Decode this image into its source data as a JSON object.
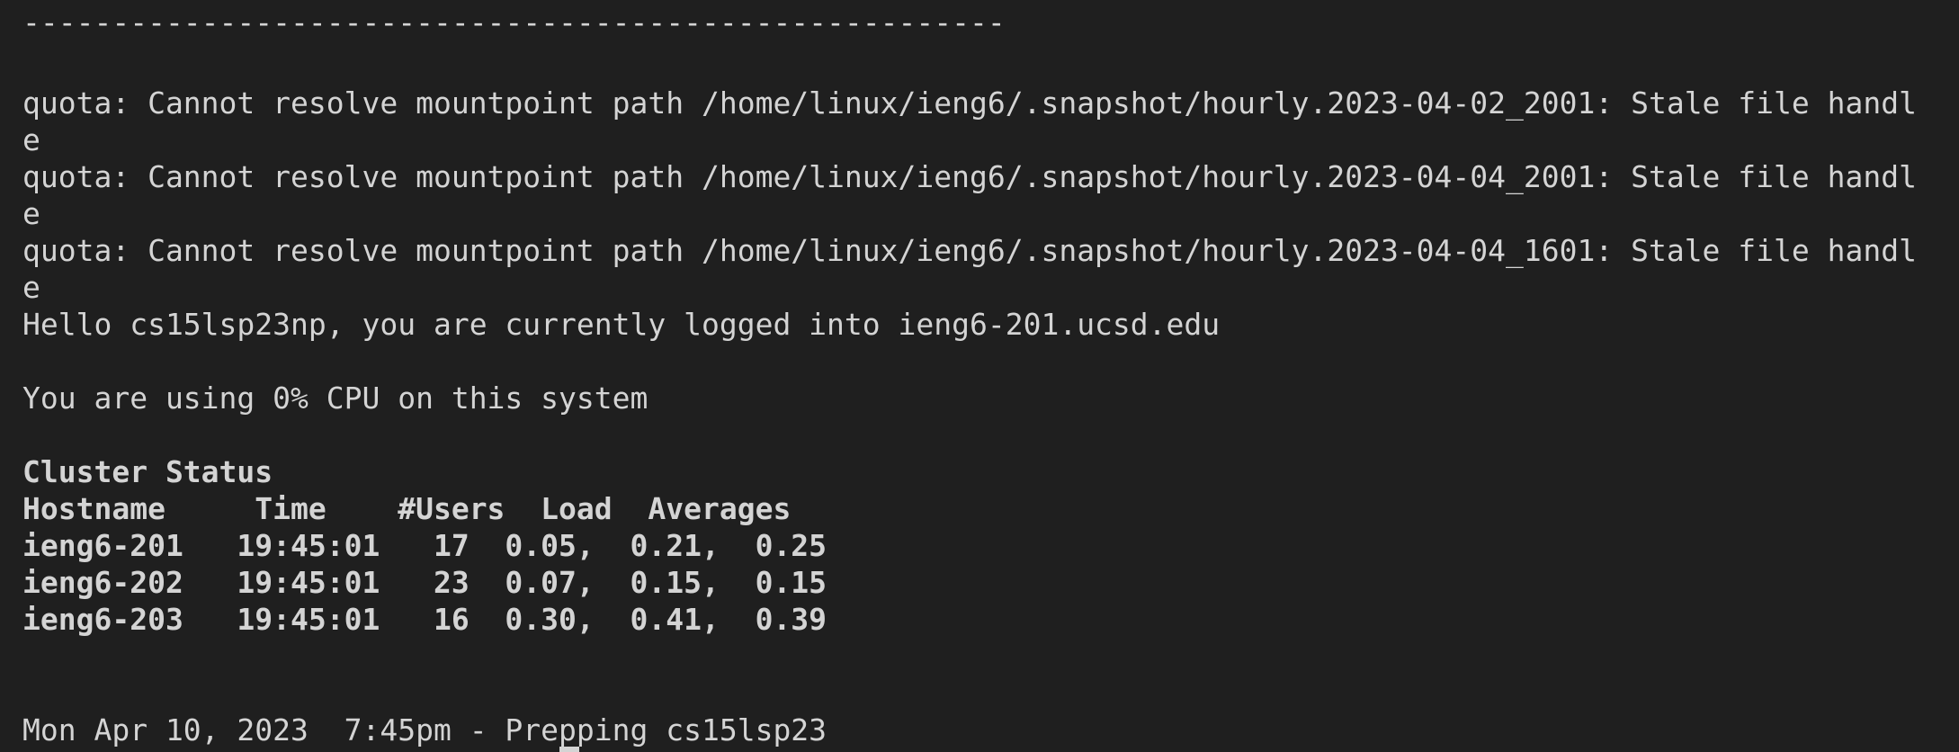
{
  "terminal": {
    "rule": "-------------------------------------------------------",
    "quota_lines": [
      "quota: Cannot resolve mountpoint path /home/linux/ieng6/.snapshot/hourly.2023-04-02_2001: Stale file handl",
      "e",
      "quota: Cannot resolve mountpoint path /home/linux/ieng6/.snapshot/hourly.2023-04-04_2001: Stale file handl",
      "e",
      "quota: Cannot resolve mountpoint path /home/linux/ieng6/.snapshot/hourly.2023-04-04_1601: Stale file handl",
      "e"
    ],
    "greeting": "Hello cs15lsp23np, you are currently logged into ieng6-201.ucsd.edu",
    "cpu_usage": "You are using 0% CPU on this system",
    "cluster_title": "Cluster Status",
    "cluster_header": "Hostname     Time    #Users  Load  Averages",
    "cluster_rows": [
      "ieng6-201   19:45:01   17  0.05,  0.21,  0.25",
      "ieng6-202   19:45:01   23  0.07,  0.15,  0.15",
      "ieng6-203   19:45:01   16  0.30,  0.41,  0.39"
    ],
    "footer": "Mon Apr 10, 2023  7:45pm - Prepping cs15lsp23"
  },
  "colors": {
    "background": "#1f1f1f",
    "foreground": "#d4d4d4"
  }
}
